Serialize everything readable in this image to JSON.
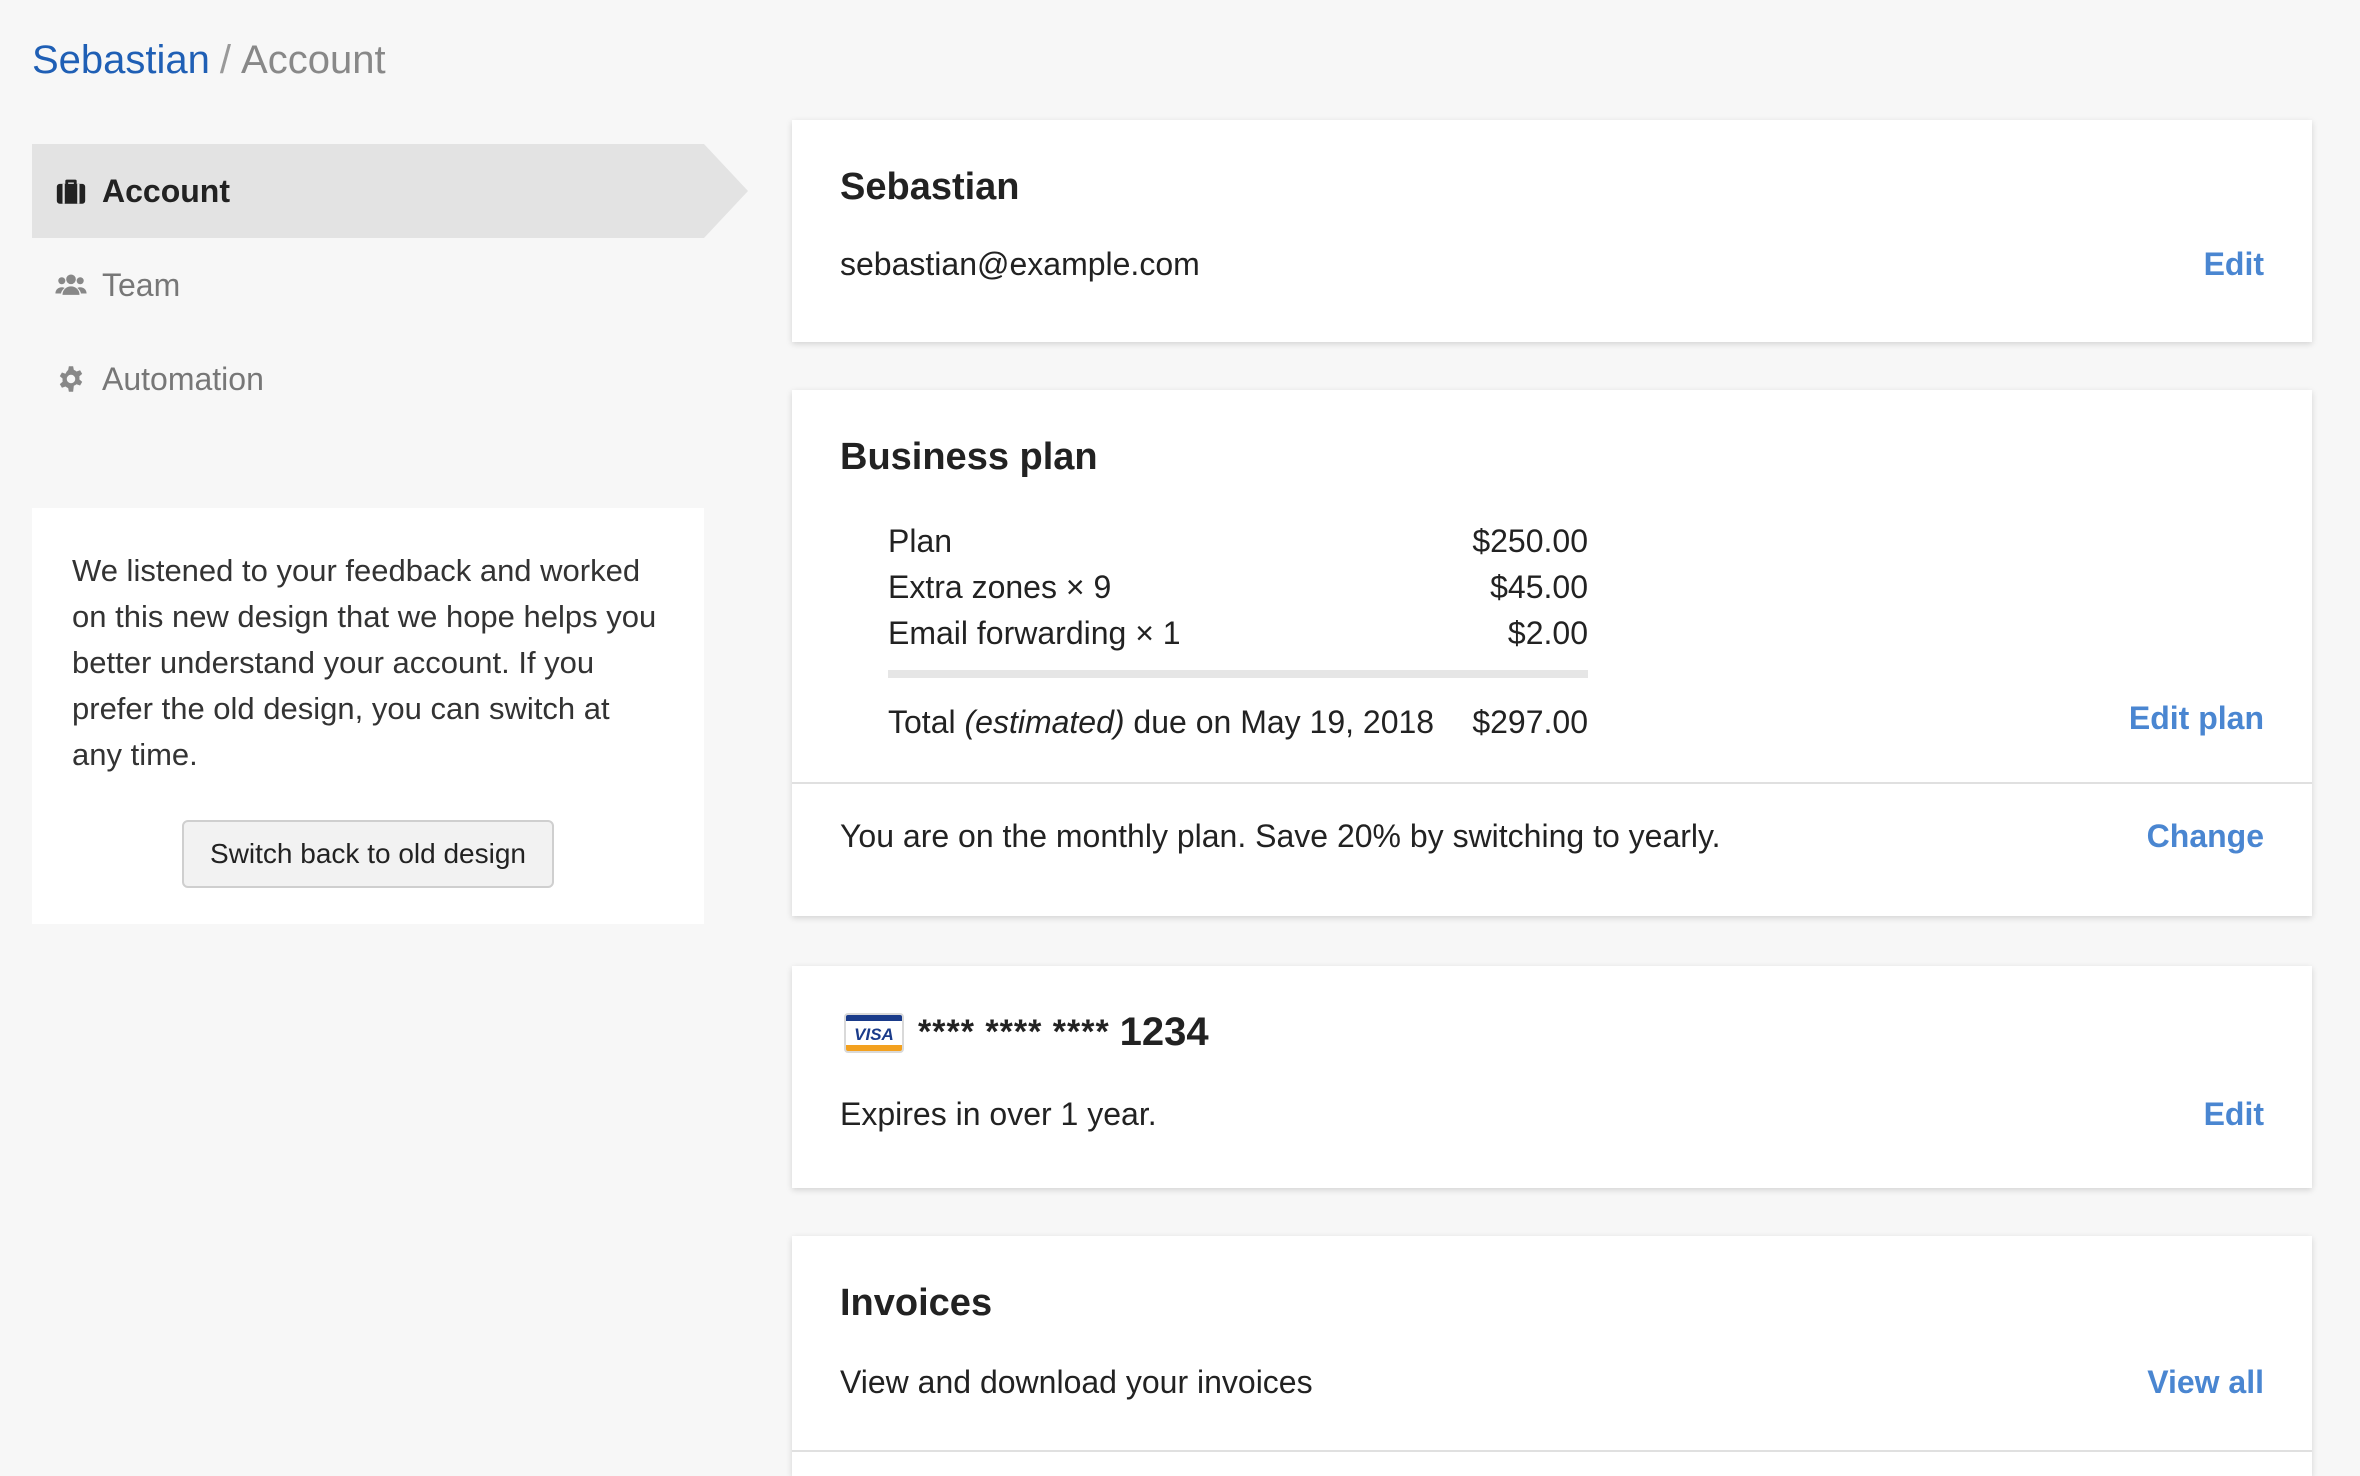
{
  "breadcrumb": {
    "parent": "Sebastian",
    "separator": "/",
    "current": "Account"
  },
  "sidebar": {
    "items": [
      {
        "label": "Account",
        "icon": "briefcase-icon",
        "active": true
      },
      {
        "label": "Team",
        "icon": "users-icon",
        "active": false
      },
      {
        "label": "Automation",
        "icon": "gear-icon",
        "active": false
      }
    ],
    "notice": {
      "text": "We listened to your feedback and worked on this new design that we hope helps you better understand your account. If you prefer the old design, you can switch at any time.",
      "button_label": "Switch back to old design"
    }
  },
  "user_card": {
    "name": "Sebastian",
    "email": "sebastian@example.com",
    "edit_label": "Edit"
  },
  "plan_card": {
    "title": "Business plan",
    "lines": [
      {
        "label": "Plan",
        "amount": "$250.00"
      },
      {
        "label": "Extra zones × 9",
        "amount": "$45.00"
      },
      {
        "label": "Email forwarding × 1",
        "amount": "$2.00"
      }
    ],
    "total_prefix": "Total",
    "total_estimated": "(estimated)",
    "total_suffix": "due on May 19, 2018",
    "total_amount": "$297.00",
    "edit_label": "Edit plan",
    "billing_note": "You are on the monthly plan. Save 20% by switching to yearly.",
    "change_label": "Change"
  },
  "payment_card": {
    "brand": "VISA",
    "masked": "**** **** ****",
    "last4": "1234",
    "expiry_note": "Expires in over 1 year.",
    "edit_label": "Edit"
  },
  "invoices_card": {
    "title": "Invoices",
    "description": "View and download your invoices",
    "view_all_label": "View all"
  },
  "colors": {
    "background": "#f7f7f7",
    "link": "#4a86d1",
    "breadcrumb_link": "#1f5fb5",
    "active_nav": "#e3e3e3"
  }
}
